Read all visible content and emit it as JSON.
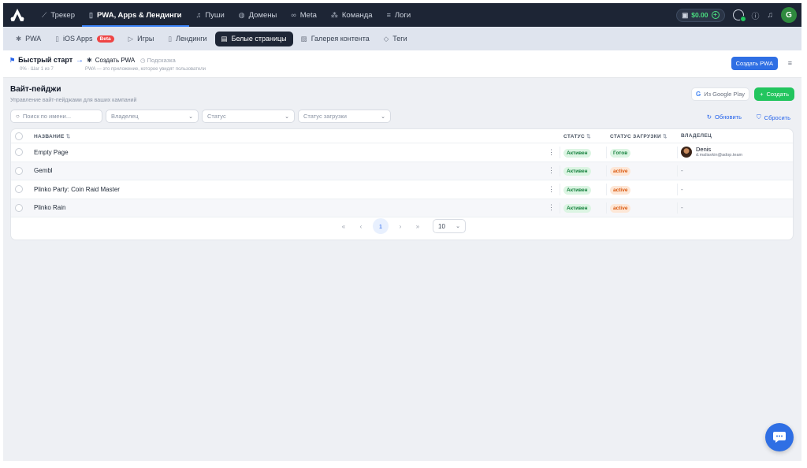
{
  "colors": {
    "nav_bg": "#1d2535",
    "accent": "#2f6fe4",
    "success": "#22c55e",
    "warning": "#d9560b"
  },
  "topnav": {
    "items": [
      {
        "icon": "chart-icon",
        "label": "Трекер"
      },
      {
        "icon": "phone-icon",
        "label": "PWA, Apps & Лендинги"
      },
      {
        "icon": "bell-icon",
        "label": "Пуши"
      },
      {
        "icon": "globe-icon",
        "label": "Домены"
      },
      {
        "icon": "meta-icon",
        "label": "Meta"
      },
      {
        "icon": "team-icon",
        "label": "Команда"
      },
      {
        "icon": "list-icon",
        "label": "Логи"
      }
    ],
    "balance": "$0.00",
    "avatar_letter": "G"
  },
  "subnav": {
    "items": [
      {
        "icon": "android-icon",
        "label": "PWA"
      },
      {
        "icon": "phone-icon",
        "label": "iOS Apps",
        "badge": "Beta"
      },
      {
        "icon": "play-icon",
        "label": "Игры"
      },
      {
        "icon": "phone-icon",
        "label": "Лендинги"
      },
      {
        "icon": "page-icon",
        "label": "Белые страницы"
      },
      {
        "icon": "gallery-icon",
        "label": "Галерея контента"
      },
      {
        "icon": "tag-icon",
        "label": "Теги"
      }
    ]
  },
  "quickstart": {
    "title": "Быстрый старт",
    "progress": "0% · Шаг 1 из 7",
    "step": "Создать PWA",
    "hint": "Подсказка",
    "description": "PWA — это приложение, которое увидят пользователи",
    "create_button": "Создать PWA"
  },
  "page": {
    "title": "Вайт-пейджи",
    "subtitle": "Управление вайт-пейджами для ваших кампаний",
    "google_button": "Из Google Play",
    "create_button": "Создать",
    "refresh": "Обновить",
    "reset": "Сбросить"
  },
  "filters": {
    "search_placeholder": "Поиск по имени...",
    "owner": "Владелец",
    "status": "Статус",
    "load_status": "Статус загрузки"
  },
  "table": {
    "headers": {
      "name": "НАЗВАНИЕ",
      "status": "СТАТУС",
      "load": "СТАТУС ЗАГРУЗКИ",
      "owner": "ВЛАДЕЛЕЦ"
    },
    "rows": [
      {
        "name": "Empty Page",
        "status": "Активен",
        "load": "Готов",
        "owner_name": "Denis",
        "owner_email": "d.maliavkin@adop.team"
      },
      {
        "name": "Gembl",
        "status": "Активен",
        "load": "active",
        "owner": "-"
      },
      {
        "name": "Plinko Party: Coin Raid Master",
        "status": "Активен",
        "load": "active",
        "owner": "-"
      },
      {
        "name": "Plinko Rain",
        "status": "Активен",
        "load": "active",
        "owner": "-"
      }
    ]
  },
  "pagination": {
    "current": "1",
    "per_page": "10"
  }
}
